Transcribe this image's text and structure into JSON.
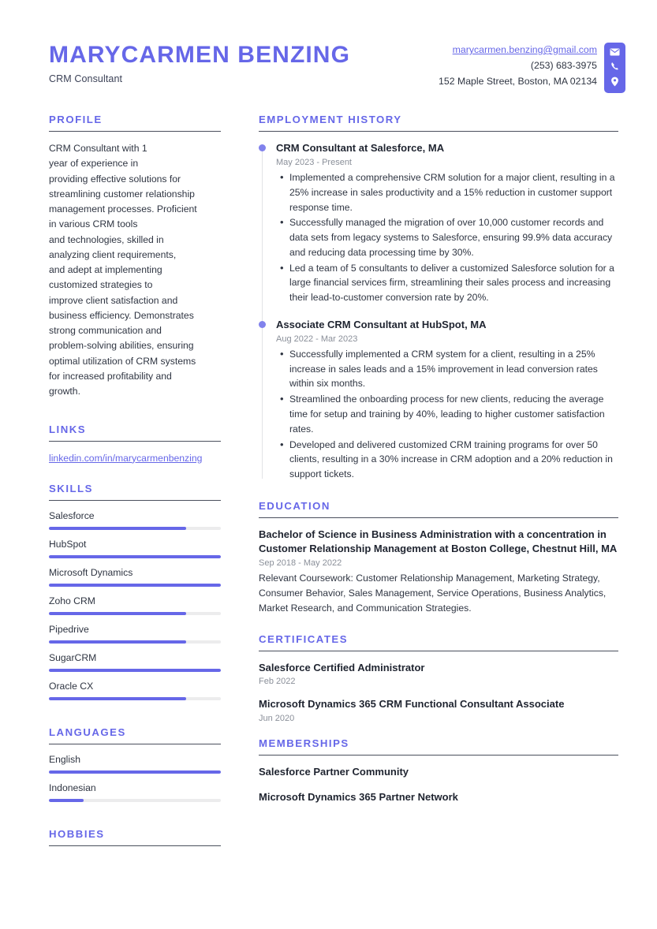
{
  "header": {
    "full_name": "MARYCARMEN BENZING",
    "job_title": "CRM Consultant",
    "email": "marycarmen.benzing@gmail.com",
    "phone": "(253) 683-3975",
    "address": "152 Maple Street, Boston, MA 02134",
    "icons": [
      "envelope-icon",
      "phone-icon",
      "location-pin-icon"
    ]
  },
  "colors": {
    "accent": "#6667e8",
    "text": "#2f3542",
    "muted": "#8a8f99",
    "track": "#ececed"
  },
  "left": {
    "profile": {
      "title": "Profile",
      "text": "CRM Consultant with 1\nyear of experience in\nproviding effective solutions for\nstreamlining customer relationship\nmanagement processes. Proficient\nin various CRM tools\nand technologies, skilled in\nanalyzing client requirements,\nand adept at implementing\ncustomized strategies to\nimprove client satisfaction and\nbusiness efficiency. Demonstrates\nstrong communication and\nproblem-solving abilities, ensuring\noptimal utilization of CRM systems\nfor increased profitability and\ngrowth."
    },
    "links": {
      "title": "Links",
      "items": [
        {
          "label": "linkedin.com/in/marycarmenbenzing"
        }
      ]
    },
    "skills": {
      "title": "Skills",
      "items": [
        {
          "label": "Salesforce",
          "level": 80
        },
        {
          "label": "HubSpot",
          "level": 100
        },
        {
          "label": "Microsoft Dynamics",
          "level": 100
        },
        {
          "label": "Zoho CRM",
          "level": 80
        },
        {
          "label": "Pipedrive",
          "level": 80
        },
        {
          "label": "SugarCRM",
          "level": 100
        },
        {
          "label": "Oracle CX",
          "level": 80
        }
      ]
    },
    "languages": {
      "title": "Languages",
      "items": [
        {
          "label": "English",
          "level": 100
        },
        {
          "label": "Indonesian",
          "level": 20
        }
      ]
    },
    "hobbies": {
      "title": "Hobbies"
    }
  },
  "right": {
    "employment": {
      "title": "Employment History",
      "jobs": [
        {
          "title": "CRM Consultant at Salesforce, MA",
          "date": "May 2023 - Present",
          "bullets": [
            "Implemented a comprehensive CRM solution for a major client, resulting in a 25% increase in sales productivity and a 15% reduction in customer support response time.",
            "Successfully managed the migration of over 10,000 customer records and data sets from legacy systems to Salesforce, ensuring 99.9% data accuracy and reducing data processing time by 30%.",
            "Led a team of 5 consultants to deliver a customized Salesforce solution for a large financial services firm, streamlining their sales process and increasing their lead-to-customer conversion rate by 20%."
          ]
        },
        {
          "title": "Associate CRM Consultant at HubSpot, MA",
          "date": "Aug 2022 - Mar 2023",
          "bullets": [
            "Successfully implemented a CRM system for a client, resulting in a 25% increase in sales leads and a 15% improvement in lead conversion rates within six months.",
            "Streamlined the onboarding process for new clients, reducing the average time for setup and training by 40%, leading to higher customer satisfaction rates.",
            "Developed and delivered customized CRM training programs for over 50 clients, resulting in a 30% increase in CRM adoption and a 20% reduction in support tickets."
          ]
        }
      ]
    },
    "education": {
      "title": "Education",
      "items": [
        {
          "title": "Bachelor of Science in Business Administration with a concentration in Customer Relationship Management at Boston College, Chestnut Hill, MA",
          "date": "Sep 2018 - May 2022",
          "description": "Relevant Coursework: Customer Relationship Management, Marketing Strategy, Consumer Behavior, Sales Management, Service Operations, Business Analytics, Market Research, and Communication Strategies."
        }
      ]
    },
    "certificates": {
      "title": "Certificates",
      "items": [
        {
          "title": "Salesforce Certified Administrator",
          "date": "Feb 2022"
        },
        {
          "title": "Microsoft Dynamics 365 CRM Functional Consultant Associate",
          "date": "Jun 2020"
        }
      ]
    },
    "memberships": {
      "title": "Memberships",
      "items": [
        {
          "title": "Salesforce Partner Community"
        },
        {
          "title": "Microsoft Dynamics 365 Partner Network"
        }
      ]
    }
  }
}
